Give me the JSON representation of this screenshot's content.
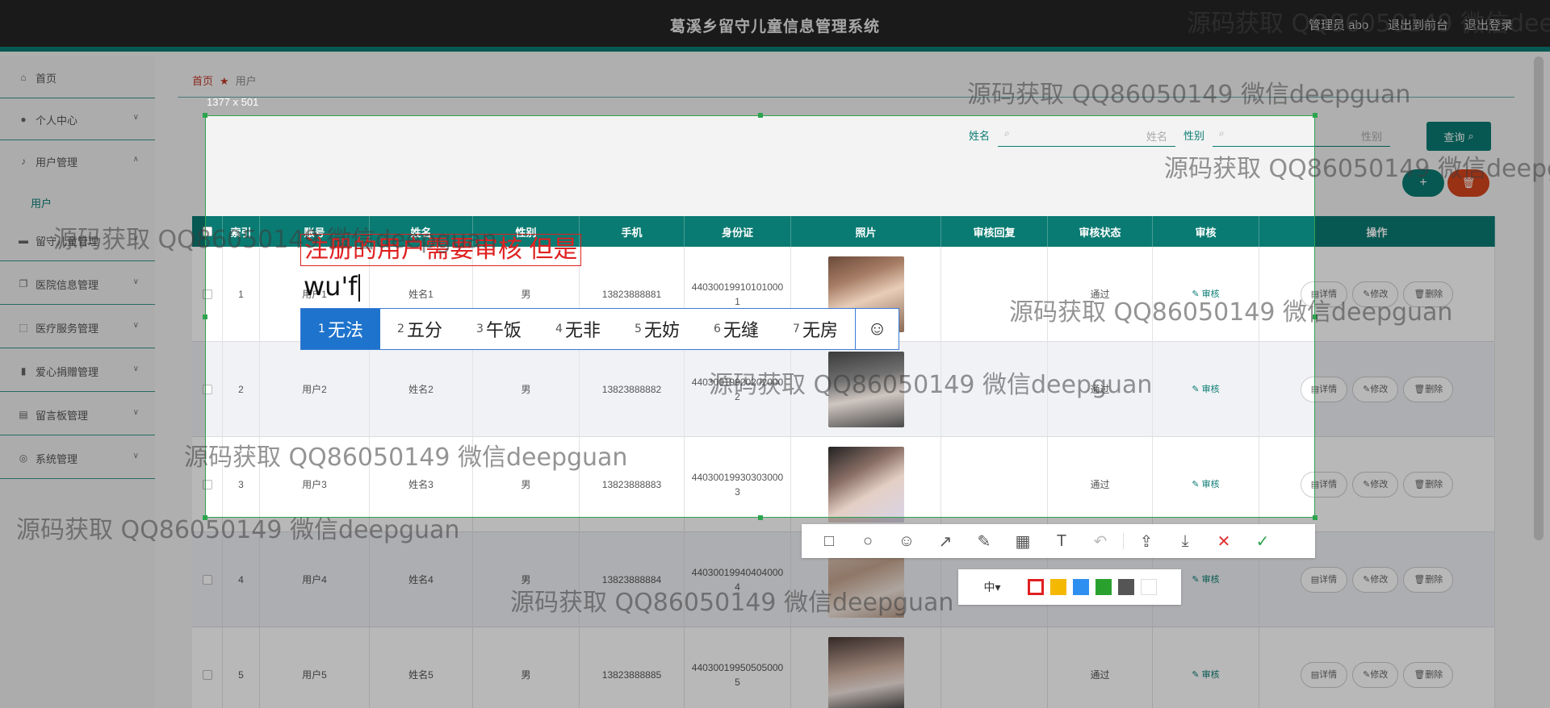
{
  "header": {
    "title": "葛溪乡留守儿童信息管理系统",
    "admin": "管理员 abo",
    "to_front": "退出到前台",
    "logout": "退出登录"
  },
  "sidebar": {
    "items": [
      {
        "label": "首页",
        "icon": "home-icon"
      },
      {
        "label": "个人中心",
        "icon": "user-icon"
      },
      {
        "label": "用户管理",
        "icon": "mic-icon"
      },
      {
        "label": "留守儿童管理",
        "icon": "monitor-icon"
      },
      {
        "label": "医院信息管理",
        "icon": "copy-icon"
      },
      {
        "label": "医疗服务管理",
        "icon": "frame-icon"
      },
      {
        "label": "爱心捐赠管理",
        "icon": "bar-chart-icon"
      },
      {
        "label": "留言板管理",
        "icon": "clipboard-icon"
      },
      {
        "label": "系统管理",
        "icon": "compass-icon"
      }
    ],
    "submenu": "用户"
  },
  "breadcrumb": {
    "home": "首页",
    "current": "用户"
  },
  "search": {
    "name_label": "姓名",
    "name_placeholder": "姓名",
    "gender_label": "性别",
    "gender_placeholder": "性别",
    "query": "查询"
  },
  "actions": {
    "add": "+",
    "delete": "🗑"
  },
  "table": {
    "headers": [
      "",
      "索引",
      "账号",
      "姓名",
      "性别",
      "手机",
      "身份证",
      "照片",
      "审核回复",
      "审核状态",
      "审核",
      "操作"
    ],
    "rows": [
      {
        "idx": "1",
        "account": "用户1",
        "name": "姓名1",
        "gender": "男",
        "phone": "13823888881",
        "id": "440300199101010001",
        "reply": "",
        "status": "通过",
        "audit": "审核"
      },
      {
        "idx": "2",
        "account": "用户2",
        "name": "姓名2",
        "gender": "男",
        "phone": "13823888882",
        "id": "440300199202020002",
        "reply": "",
        "status": "通过",
        "audit": "审核"
      },
      {
        "idx": "3",
        "account": "用户3",
        "name": "姓名3",
        "gender": "男",
        "phone": "13823888883",
        "id": "440300199303030003",
        "reply": "",
        "status": "通过",
        "audit": "审核"
      },
      {
        "idx": "4",
        "account": "用户4",
        "name": "姓名4",
        "gender": "男",
        "phone": "13823888884",
        "id": "440300199404040004",
        "reply": "",
        "status": "通过",
        "audit": "审核"
      },
      {
        "idx": "5",
        "account": "用户5",
        "name": "姓名5",
        "gender": "男",
        "phone": "13823888885",
        "id": "440300199505050005",
        "reply": "",
        "status": "通过",
        "audit": "审核"
      }
    ],
    "op_detail": "详情",
    "op_edit": "修改",
    "op_delete": "删除"
  },
  "capture": {
    "size": "1377 x 501",
    "annotation": "注册的用户需要审核 但是",
    "ime_input": "wu'f",
    "candidates": [
      {
        "n": "1",
        "text": "无法"
      },
      {
        "n": "2",
        "text": "五分"
      },
      {
        "n": "3",
        "text": "午饭"
      },
      {
        "n": "4",
        "text": "无非"
      },
      {
        "n": "5",
        "text": "无妨"
      },
      {
        "n": "6",
        "text": "无缝"
      },
      {
        "n": "7",
        "text": "无房"
      }
    ],
    "emoji": "☺",
    "font_size": "中",
    "tools": [
      "rectangle-icon",
      "ellipse-icon",
      "sticker-icon",
      "arrow-icon",
      "pen-icon",
      "mosaic-icon",
      "text-icon",
      "undo-icon",
      "share-icon",
      "download-icon",
      "cancel-icon",
      "confirm-icon"
    ],
    "colors": [
      "#e02020",
      "#f5b800",
      "#2f8ff0",
      "#2aa12f",
      "#555555",
      "#ffffff"
    ]
  },
  "watermark": "源码获取 QQ86050149 微信deepguan"
}
